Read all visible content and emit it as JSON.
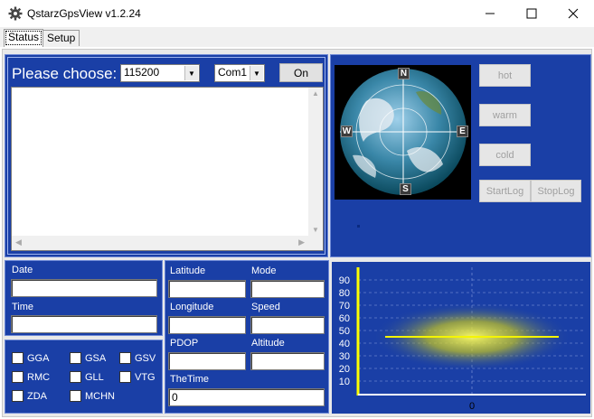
{
  "window": {
    "title": "QstarzGpsView v1.2.24",
    "minimize": "—",
    "maximize": "☐",
    "close": "✕"
  },
  "tabs": [
    {
      "label": "Status"
    },
    {
      "label": "Setup"
    }
  ],
  "connection": {
    "prompt": "Please choose:",
    "baud": "115200",
    "port": "Com1",
    "on_label": "On"
  },
  "sky": {
    "n": "N",
    "w": "W",
    "e": "E",
    "s": "S"
  },
  "start_buttons": {
    "hot": "hot",
    "warm": "warm",
    "cold": "cold"
  },
  "log_buttons": {
    "start": "StartLog",
    "stop": "StopLog"
  },
  "datetime": {
    "date_label": "Date",
    "date_value": "",
    "time_label": "Time",
    "time_value": ""
  },
  "position": {
    "latitude_label": "Latitude",
    "latitude_value": "",
    "mode_label": "Mode",
    "mode_value": "",
    "longitude_label": "Longitude",
    "longitude_value": "",
    "speed_label": "Speed",
    "speed_value": "",
    "pdop_label": "PDOP",
    "pdop_value": "",
    "altitude_label": "Altitude",
    "altitude_value": "",
    "thetime_label": "TheTime",
    "thetime_value": "0"
  },
  "sentences": [
    {
      "label": "GGA"
    },
    {
      "label": "GSA"
    },
    {
      "label": "GSV"
    },
    {
      "label": "RMC"
    },
    {
      "label": "GLL"
    },
    {
      "label": "VTG"
    },
    {
      "label": "ZDA"
    },
    {
      "label": "MCHN"
    }
  ],
  "colors": {
    "panel_blue": "#1a3fa6",
    "trace_yellow": "#f5f500"
  },
  "chart_data": {
    "type": "line",
    "title": "",
    "xlabel": "",
    "ylabel": "",
    "ylim": [
      0,
      100
    ],
    "y_ticks": [
      "10",
      "20",
      "30",
      "40",
      "50",
      "60",
      "70",
      "80",
      "90"
    ],
    "x_ticks": [
      "0"
    ],
    "grid": true,
    "series": [
      {
        "values": [
          45,
          45
        ]
      }
    ]
  }
}
